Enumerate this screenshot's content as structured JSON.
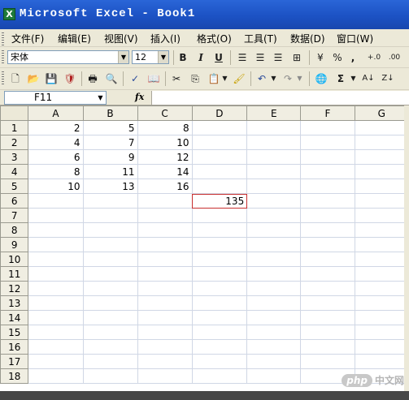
{
  "window": {
    "title": "Microsoft Excel - Book1",
    "app_icon": "X"
  },
  "menubar": {
    "items": [
      "文件(F)",
      "编辑(E)",
      "视图(V)",
      "插入(I)",
      "格式(O)",
      "工具(T)",
      "数据(D)",
      "窗口(W)"
    ]
  },
  "formatting": {
    "font_name": "宋体",
    "font_size": "12",
    "bold": "B",
    "italic": "I",
    "underline": "U",
    "percent": "%",
    "comma": ",",
    "inc_decimal": "+.0",
    "dec_decimal": ".00"
  },
  "standard": {
    "autosum": "Σ"
  },
  "formula_bar": {
    "name_box": "F11",
    "fx": "fx",
    "content": ""
  },
  "sheet": {
    "columns": [
      "A",
      "B",
      "C",
      "D",
      "E",
      "F",
      "G"
    ],
    "rows": [
      "1",
      "2",
      "3",
      "4",
      "5",
      "6",
      "7",
      "8",
      "9",
      "10",
      "11",
      "12",
      "13",
      "14",
      "15",
      "16",
      "17",
      "18"
    ],
    "cells": {
      "A1": "2",
      "B1": "5",
      "C1": "8",
      "A2": "4",
      "B2": "7",
      "C2": "10",
      "A3": "6",
      "B3": "9",
      "C3": "12",
      "A4": "8",
      "B4": "11",
      "C4": "14",
      "A5": "10",
      "B5": "13",
      "C5": "16",
      "D6": "135"
    },
    "selected_cell": "D6"
  },
  "watermark": {
    "badge": "php",
    "text": "中文网"
  },
  "colors": {
    "title_bar": "#1c52c4",
    "toolbar_bg": "#ece9d8",
    "grid_line": "#d0d7e5",
    "selection": "#c73030"
  }
}
